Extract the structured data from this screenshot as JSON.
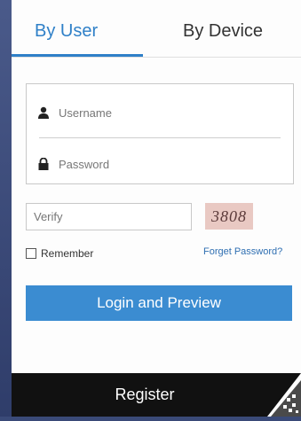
{
  "tabs": [
    {
      "label": "By User"
    },
    {
      "label": "By Device"
    }
  ],
  "fields": {
    "username_placeholder": "Username",
    "password_placeholder": "Password",
    "verify_placeholder": "Verify"
  },
  "captcha": {
    "code": "3808"
  },
  "remember": {
    "label": "Remember",
    "checked": false
  },
  "links": {
    "forgot_password": "Forget Password?"
  },
  "buttons": {
    "login": "Login and Preview",
    "register": "Register"
  },
  "colors": {
    "accent": "#2f80c8",
    "button": "#3b8cd1",
    "register_bar": "#111111"
  }
}
